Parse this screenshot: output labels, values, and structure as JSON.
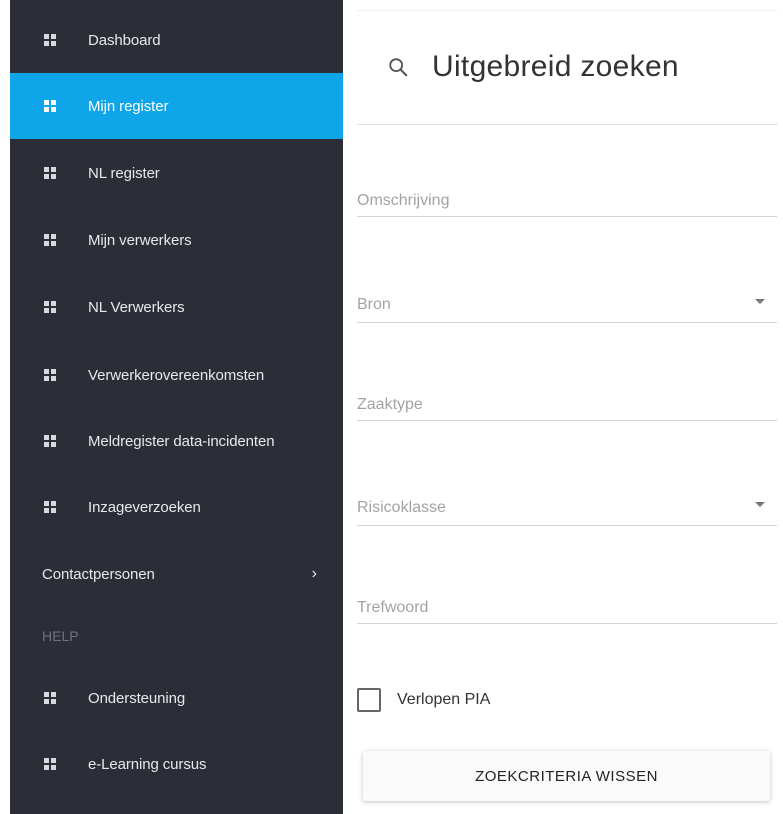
{
  "sidebar": {
    "items": [
      {
        "label": "Dashboard",
        "icon": "grid-icon"
      },
      {
        "label": "Mijn register",
        "icon": "grid-icon",
        "active": true
      },
      {
        "label": "NL register",
        "icon": "grid-icon"
      },
      {
        "label": "Mijn verwerkers",
        "icon": "grid-icon"
      },
      {
        "label": "NL Verwerkers",
        "icon": "grid-icon"
      },
      {
        "label": "Verwerkerovereenkomsten",
        "icon": "grid-icon"
      },
      {
        "label": "Meldregister data-incidenten",
        "icon": "grid-icon"
      },
      {
        "label": "Inzageverzoeken",
        "icon": "grid-icon"
      }
    ],
    "contact": {
      "label": "Contactpersonen",
      "chevron": "›"
    },
    "help_header": "HELP",
    "help_items": [
      {
        "label": "Ondersteuning",
        "icon": "grid-icon"
      },
      {
        "label": "e-Learning cursus",
        "icon": "grid-icon"
      }
    ]
  },
  "search": {
    "title": "Uitgebreid zoeken",
    "fields": {
      "omschrijving": {
        "placeholder": "Omschrijving",
        "value": ""
      },
      "bron": {
        "placeholder": "Bron",
        "type": "select"
      },
      "zaaktype": {
        "placeholder": "Zaaktype",
        "value": ""
      },
      "risicoklasse": {
        "placeholder": "Risicoklasse",
        "type": "select"
      },
      "trefwoord": {
        "placeholder": "Trefwoord",
        "value": ""
      }
    },
    "checkbox_label": "Verlopen PIA",
    "checkbox_checked": false,
    "clear_button": "ZOEKCRITERIA WISSEN"
  },
  "colors": {
    "sidebar_bg": "#2b2e37",
    "active_bg": "#0ea5e9"
  }
}
